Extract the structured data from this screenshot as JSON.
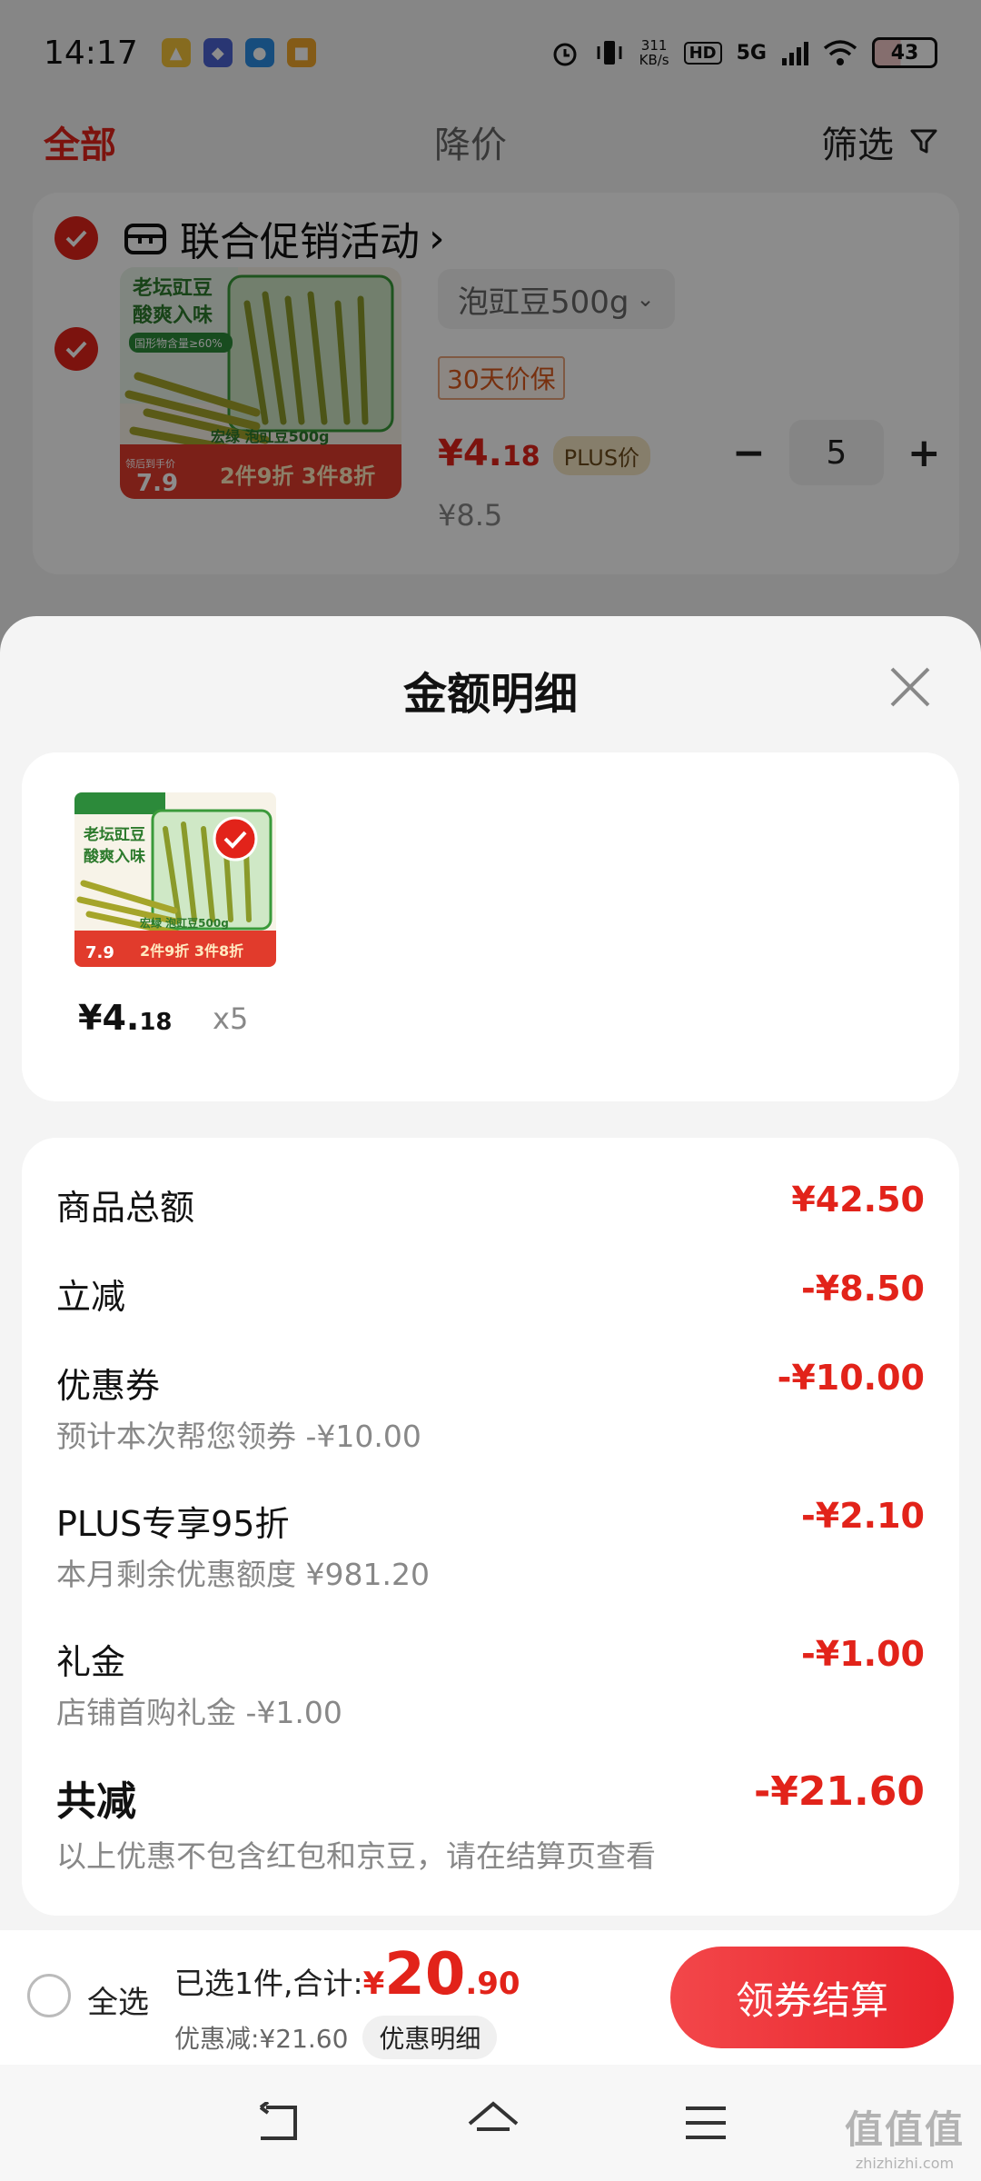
{
  "status_bar": {
    "time": "14:17",
    "net_speed_value": "311",
    "net_speed_unit": "KB/s",
    "hd": "HD",
    "signal": "5G",
    "battery": "43"
  },
  "tabs": {
    "all": "全部",
    "price_drop": "降价",
    "filter": "筛选"
  },
  "cart_item": {
    "promo": "联合促销活动",
    "variant": "泡豇豆500g",
    "guarantee": "30天价保",
    "price_int": "¥4.",
    "price_dec": "18",
    "plus_tag": "PLUS价",
    "original_price": "¥8.5",
    "quantity": "5",
    "minus": "−",
    "plus": "+"
  },
  "package": {
    "brand": "老坛豇豆",
    "slogan": "酸爽入味",
    "note": "国形物含量≥60%",
    "tag": "宏绿 泡豇豆500g",
    "promo": "2件9折 3件8折",
    "price_label": "领后到手价",
    "price": "7.9"
  },
  "sheet": {
    "title": "金额明细",
    "goods_price_int": "¥4.",
    "goods_price_dec": "18",
    "goods_qty": "x5",
    "rows": [
      {
        "label": "商品总额",
        "amount": "¥42.50",
        "sub": ""
      },
      {
        "label": "立减",
        "amount": "-¥8.50",
        "sub": ""
      },
      {
        "label": "优惠券",
        "amount": "-¥10.00",
        "sub": "预计本次帮您领券 -¥10.00"
      },
      {
        "label": "PLUS专享95折",
        "amount": "-¥2.10",
        "sub": "本月剩余优惠额度 ¥981.20"
      },
      {
        "label": "礼金",
        "amount": "-¥1.00",
        "sub": "店铺首购礼金 -¥1.00"
      },
      {
        "label": "共减",
        "amount": "-¥21.60",
        "sub": "以上优惠不包含红包和京豆，请在结算页查看"
      }
    ]
  },
  "checkout": {
    "select_all": "全选",
    "summary_prefix": "已选1件,合计:",
    "currency": "¥",
    "total_int": "20",
    "total_dec": ".90",
    "discount": "优惠减:¥21.60",
    "detail_button": "优惠明细",
    "checkout_button": "领券结算"
  },
  "watermark": {
    "main": "值值值",
    "sub": "zhizhizhi.com"
  },
  "colors": {
    "accent": "#e2231a",
    "button": "#ee2e33"
  }
}
